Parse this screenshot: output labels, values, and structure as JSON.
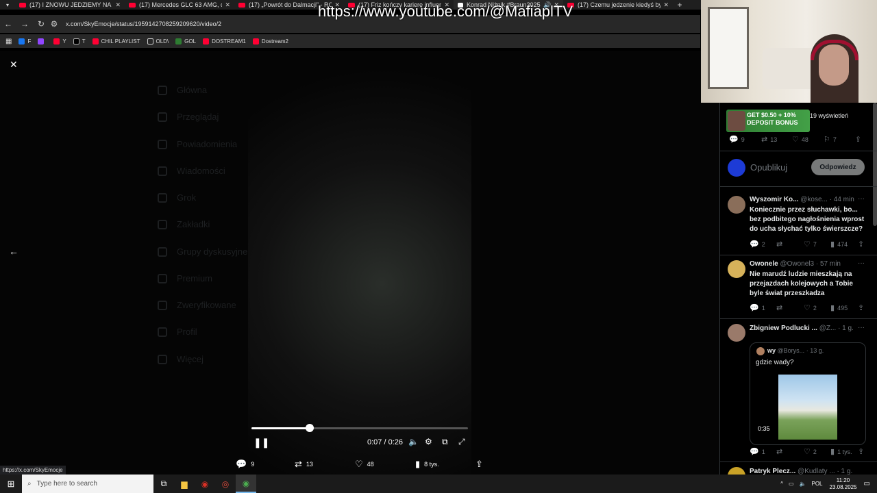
{
  "browser": {
    "tabs": [
      {
        "title": "(17) I ZNOWU JEDZIEMY NA RE"
      },
      {
        "title": "(17) Mercedes GLC 63 AMG, cz"
      },
      {
        "title": "(17) „Powrót do Dalmacji” - RC"
      },
      {
        "title": "(17) Friz kończy karierę influen"
      },
      {
        "title": "Konrad Niżnik #Braun2025"
      },
      {
        "title": "(17) Czemu jedzenie kiedyś było"
      }
    ],
    "new_tab": "+",
    "url": "x.com/SkyEmocje/status/1959142708259209620/video/2",
    "bookmarks": [
      {
        "label": "F",
        "color": "#1877f2"
      },
      {
        "label": "",
        "color": "#9146ff"
      },
      {
        "label": "Y",
        "color": "#ff0033"
      },
      {
        "label": "T",
        "color": "#000000"
      },
      {
        "label": "CHIL PLAYLIST",
        "color": "#ff0033"
      },
      {
        "label": "OLD\\",
        "color": "#444444"
      },
      {
        "label": "GOL",
        "color": "#2e7d32"
      },
      {
        "label": "DOSTREAM1",
        "color": "#ff0033"
      },
      {
        "label": "Dostream2",
        "color": "#ff0033"
      }
    ],
    "status_link": "https://x.com/SkyEmocje"
  },
  "watermark": "https://www.youtube.com/@MafiaplTV",
  "page_nav": [
    "Główna",
    "Przeglądaj",
    "Powiadomienia",
    "Wiadomości",
    "Grok",
    "Zakładki",
    "Grupy dyskusyjne",
    "Premium",
    "Zweryfikowane",
    "Profil",
    "Więcej"
  ],
  "player": {
    "time": "0:07 / 0:26",
    "progress_fraction": 0.27
  },
  "actions": {
    "replies": "9",
    "reposts": "13",
    "likes": "48",
    "views": "8 tys."
  },
  "panel": {
    "ad": {
      "line1": "GET $0.50 + 10%",
      "line2": "DEPOSIT BONUS"
    },
    "views_text": "19 wyświetleń",
    "stats": {
      "replies": "9",
      "reposts": "13",
      "likes": "48",
      "bookmarks": "7"
    },
    "reply_placeholder": "Opublikuj",
    "reply_button": "Odpowiedz",
    "comments": [
      {
        "name": "Wyszomir Ko...",
        "handle": "@kose...",
        "time": "· 44 min",
        "text": "Koniecznie przez słuchawki, bo... bez podbitego nagłośnienia wprost do ucha słychać tylko świerszcze?",
        "replies": "2",
        "reposts": "",
        "likes": "7",
        "views": "474",
        "avatar": "#8a6e5a"
      },
      {
        "name": "Owonele",
        "handle": "@Owonel3",
        "time": "· 57 min",
        "text": "Nie marudź ludzie mieszkają na przejazdach kolejowych a Tobie byle świat przeszkadza",
        "replies": "1",
        "reposts": "",
        "likes": "2",
        "views": "495",
        "avatar": "#d6b25a"
      },
      {
        "name": "Zbigniew Podlucki ...",
        "handle": "@Z...",
        "time": "· 1 g.",
        "text": "",
        "replies": "1",
        "reposts": "",
        "likes": "2",
        "views": "1 tys.",
        "avatar": "#9a7a6a"
      },
      {
        "name": "Patryk Plecz...",
        "handle": "@Kudlaty ...",
        "time": "· 1 g.",
        "text": "",
        "avatar": "#c9a227"
      }
    ],
    "quote": {
      "name": "wy",
      "handle": "@Borys...",
      "time": "· 13 g.",
      "text": "gdzie wady?",
      "duration": "0:35"
    }
  },
  "taskbar": {
    "search_placeholder": "Type here to search",
    "language": "POL",
    "time": "11:20",
    "date": "23.08.2025"
  }
}
